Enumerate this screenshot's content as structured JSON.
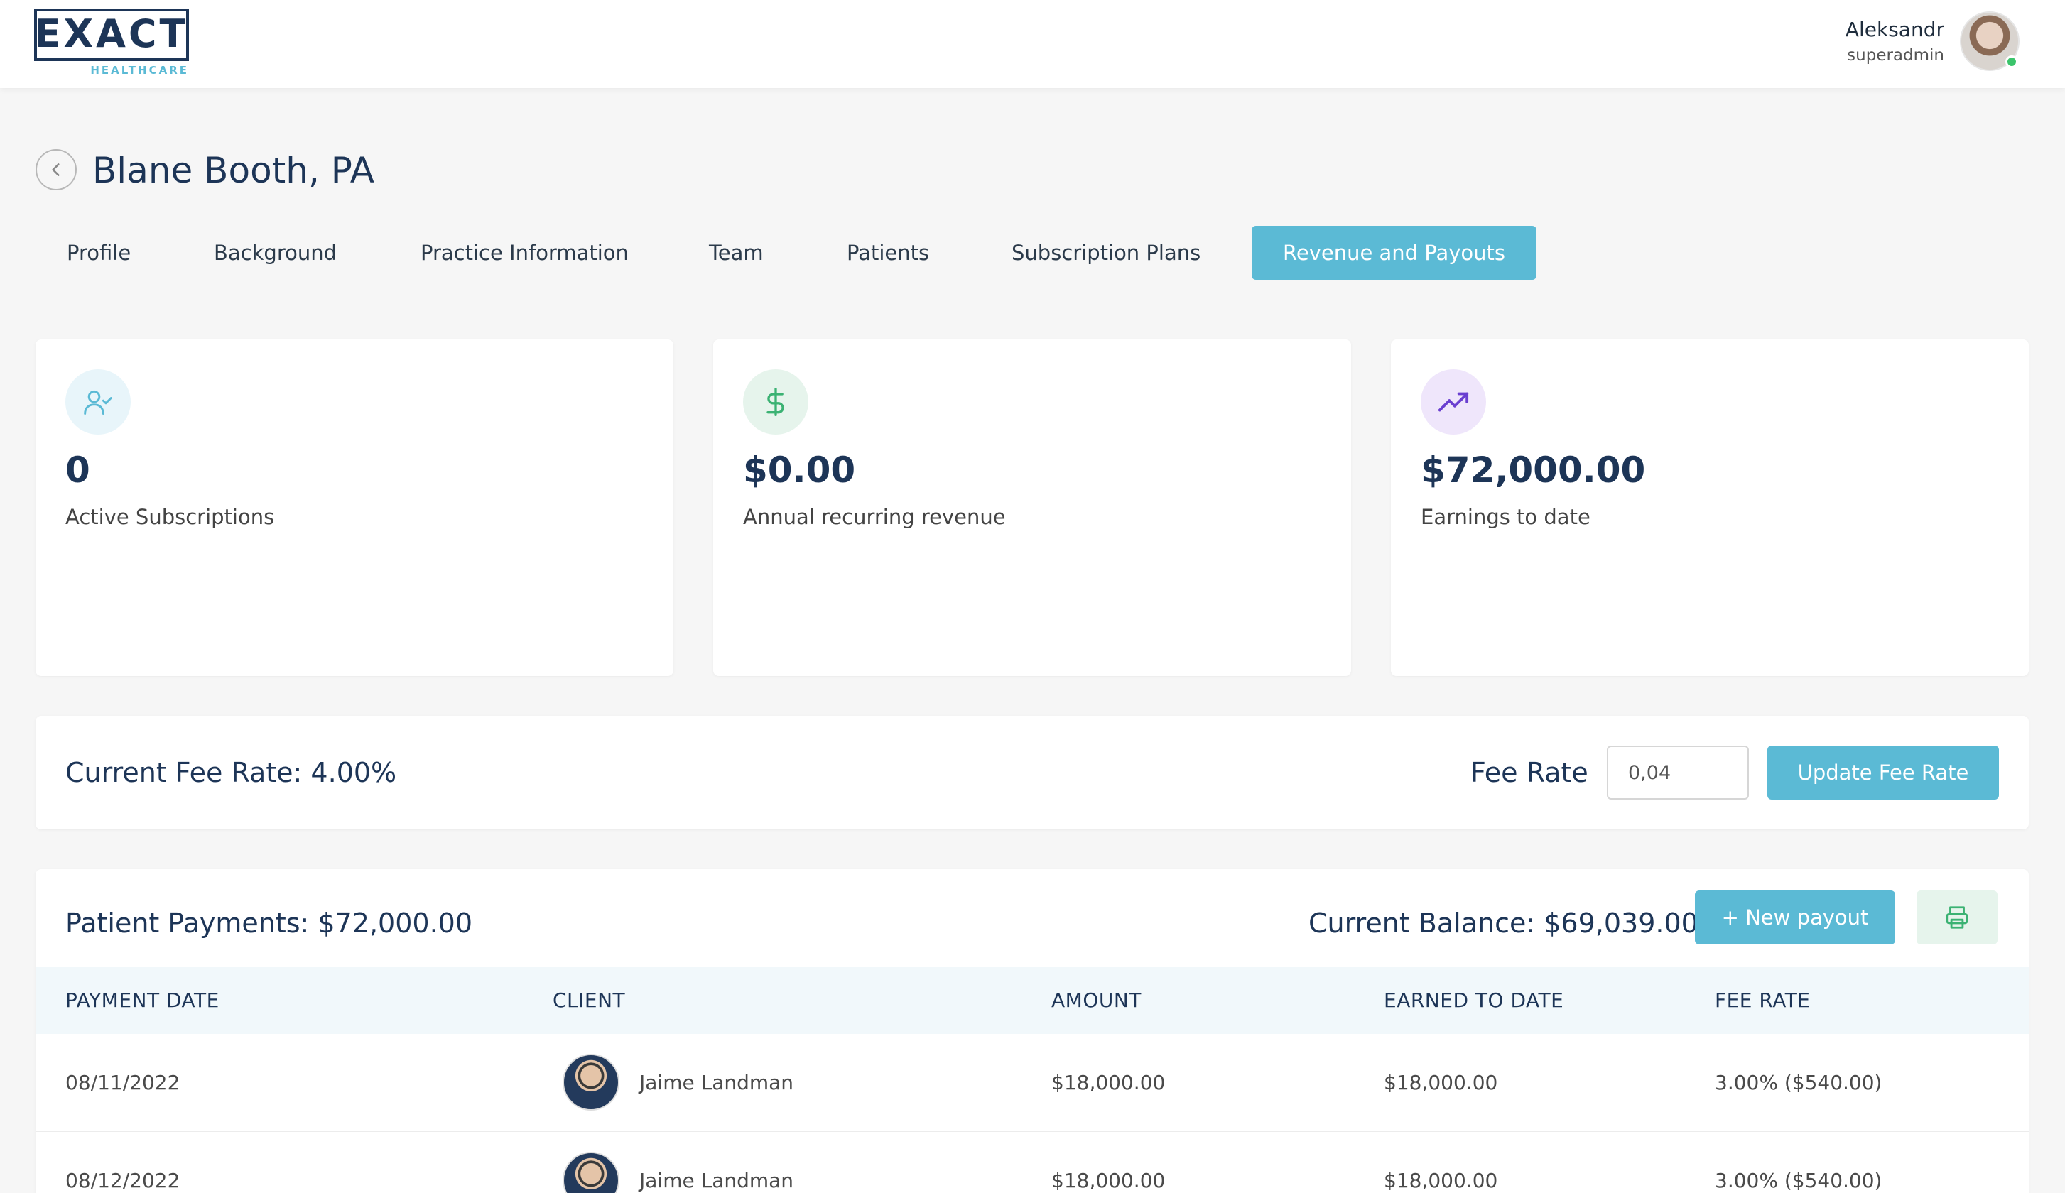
{
  "header": {
    "logo_text": "EXACT",
    "logo_sub": "HEALTHCARE",
    "user_name": "Aleksandr",
    "user_role": "superadmin"
  },
  "page": {
    "title": "Blane Booth, PA"
  },
  "tabs": [
    {
      "label": "Profile",
      "active": false
    },
    {
      "label": "Background",
      "active": false
    },
    {
      "label": "Practice Information",
      "active": false
    },
    {
      "label": "Team",
      "active": false
    },
    {
      "label": "Patients",
      "active": false
    },
    {
      "label": "Subscription Plans",
      "active": false
    },
    {
      "label": "Revenue and Payouts",
      "active": true
    }
  ],
  "stats": [
    {
      "icon": "user-check-icon",
      "value": "0",
      "label": "Active Subscriptions",
      "icon_bg": "#e8f5fa",
      "icon_color": "#5bbad5"
    },
    {
      "icon": "dollar-icon",
      "value": "$0.00",
      "label": "Annual recurring revenue",
      "icon_bg": "#e6f4ec",
      "icon_color": "#3bb273"
    },
    {
      "icon": "trending-up-icon",
      "value": "$72,000.00",
      "label": "Earnings to date",
      "icon_bg": "#efe6fb",
      "icon_color": "#6a3fd0"
    }
  ],
  "fee": {
    "current": "Current Fee Rate: 4.00%",
    "label": "Fee Rate",
    "input_value": "0,04",
    "button": "Update Fee Rate"
  },
  "payments": {
    "title": "Patient Payments: $72,000.00",
    "balance": "Current Balance: $69,039.00",
    "new_payout": "+ New payout",
    "columns": [
      "PAYMENT DATE",
      "CLIENT",
      "AMOUNT",
      "EARNED TO DATE",
      "FEE RATE"
    ],
    "rows": [
      {
        "date": "08/11/2022",
        "client": "Jaime Landman",
        "amount": "$18,000.00",
        "earned": "$18,000.00",
        "fee": "3.00% ($540.00)"
      },
      {
        "date": "08/12/2022",
        "client": "Jaime Landman",
        "amount": "$18,000.00",
        "earned": "$18,000.00",
        "fee": "3.00% ($540.00)"
      }
    ]
  },
  "colors": {
    "accent": "#5bbad5",
    "navy": "#1d3557",
    "online": "#3bc46b"
  }
}
